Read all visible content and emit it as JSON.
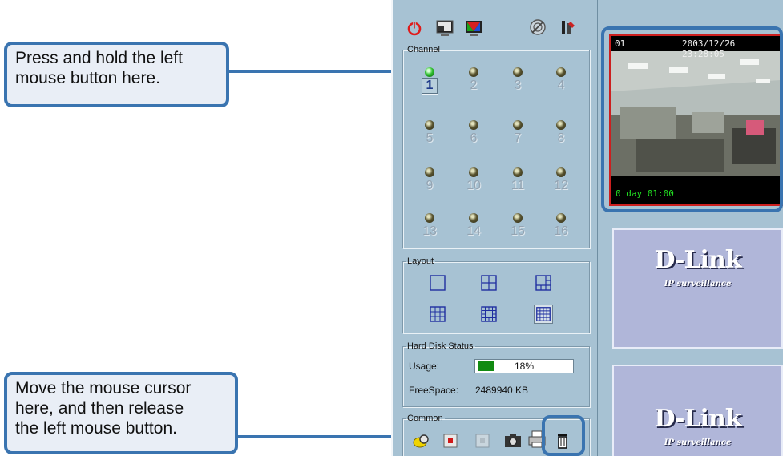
{
  "callouts": {
    "top": {
      "line1": "Press and hold the left",
      "line2": "mouse button here."
    },
    "bottom": {
      "line1": "Move the mouse cursor",
      "line2": "here, and then release",
      "line3": "the left mouse button."
    }
  },
  "toolbar": {
    "icons": [
      "power-icon",
      "fullscreen-icon",
      "color-icon",
      "disc-icon",
      "tools-icon"
    ]
  },
  "channel": {
    "legend": "Channel",
    "active": "1",
    "items": [
      "1",
      "2",
      "3",
      "4",
      "5",
      "6",
      "7",
      "8",
      "9",
      "10",
      "11",
      "12",
      "13",
      "14",
      "15",
      "16"
    ]
  },
  "layout": {
    "legend": "Layout",
    "options": [
      "1x1",
      "2x2",
      "1+5",
      "3x3",
      "1+12",
      "4x4"
    ],
    "selected": "4x4"
  },
  "hard_disk": {
    "legend": "Hard Disk Status",
    "usage_label": "Usage:",
    "usage_value": "18%",
    "usage_fraction": 0.18,
    "free_label": "FreeSpace:",
    "free_value": "2489940 KB"
  },
  "common": {
    "legend": "Common",
    "icons": [
      "search-icon",
      "record-icon",
      "stop-icon",
      "snapshot-icon",
      "print-icon",
      "trash-icon"
    ]
  },
  "video": {
    "channel_label": "01",
    "timestamp": "2003/12/26 23:28:05",
    "elapsed": "0 day 01:00"
  },
  "thumbnails": [
    {
      "brand": "D-Link",
      "tagline": "IP surveillance"
    },
    {
      "brand": "D-Link",
      "tagline": "IP surveillance"
    }
  ],
  "colors": {
    "callout_border": "#3a74b0",
    "panel_bg": "#a7c2d3",
    "active_video_border": "#cc1f1f",
    "usage_fill": "#118a11"
  }
}
